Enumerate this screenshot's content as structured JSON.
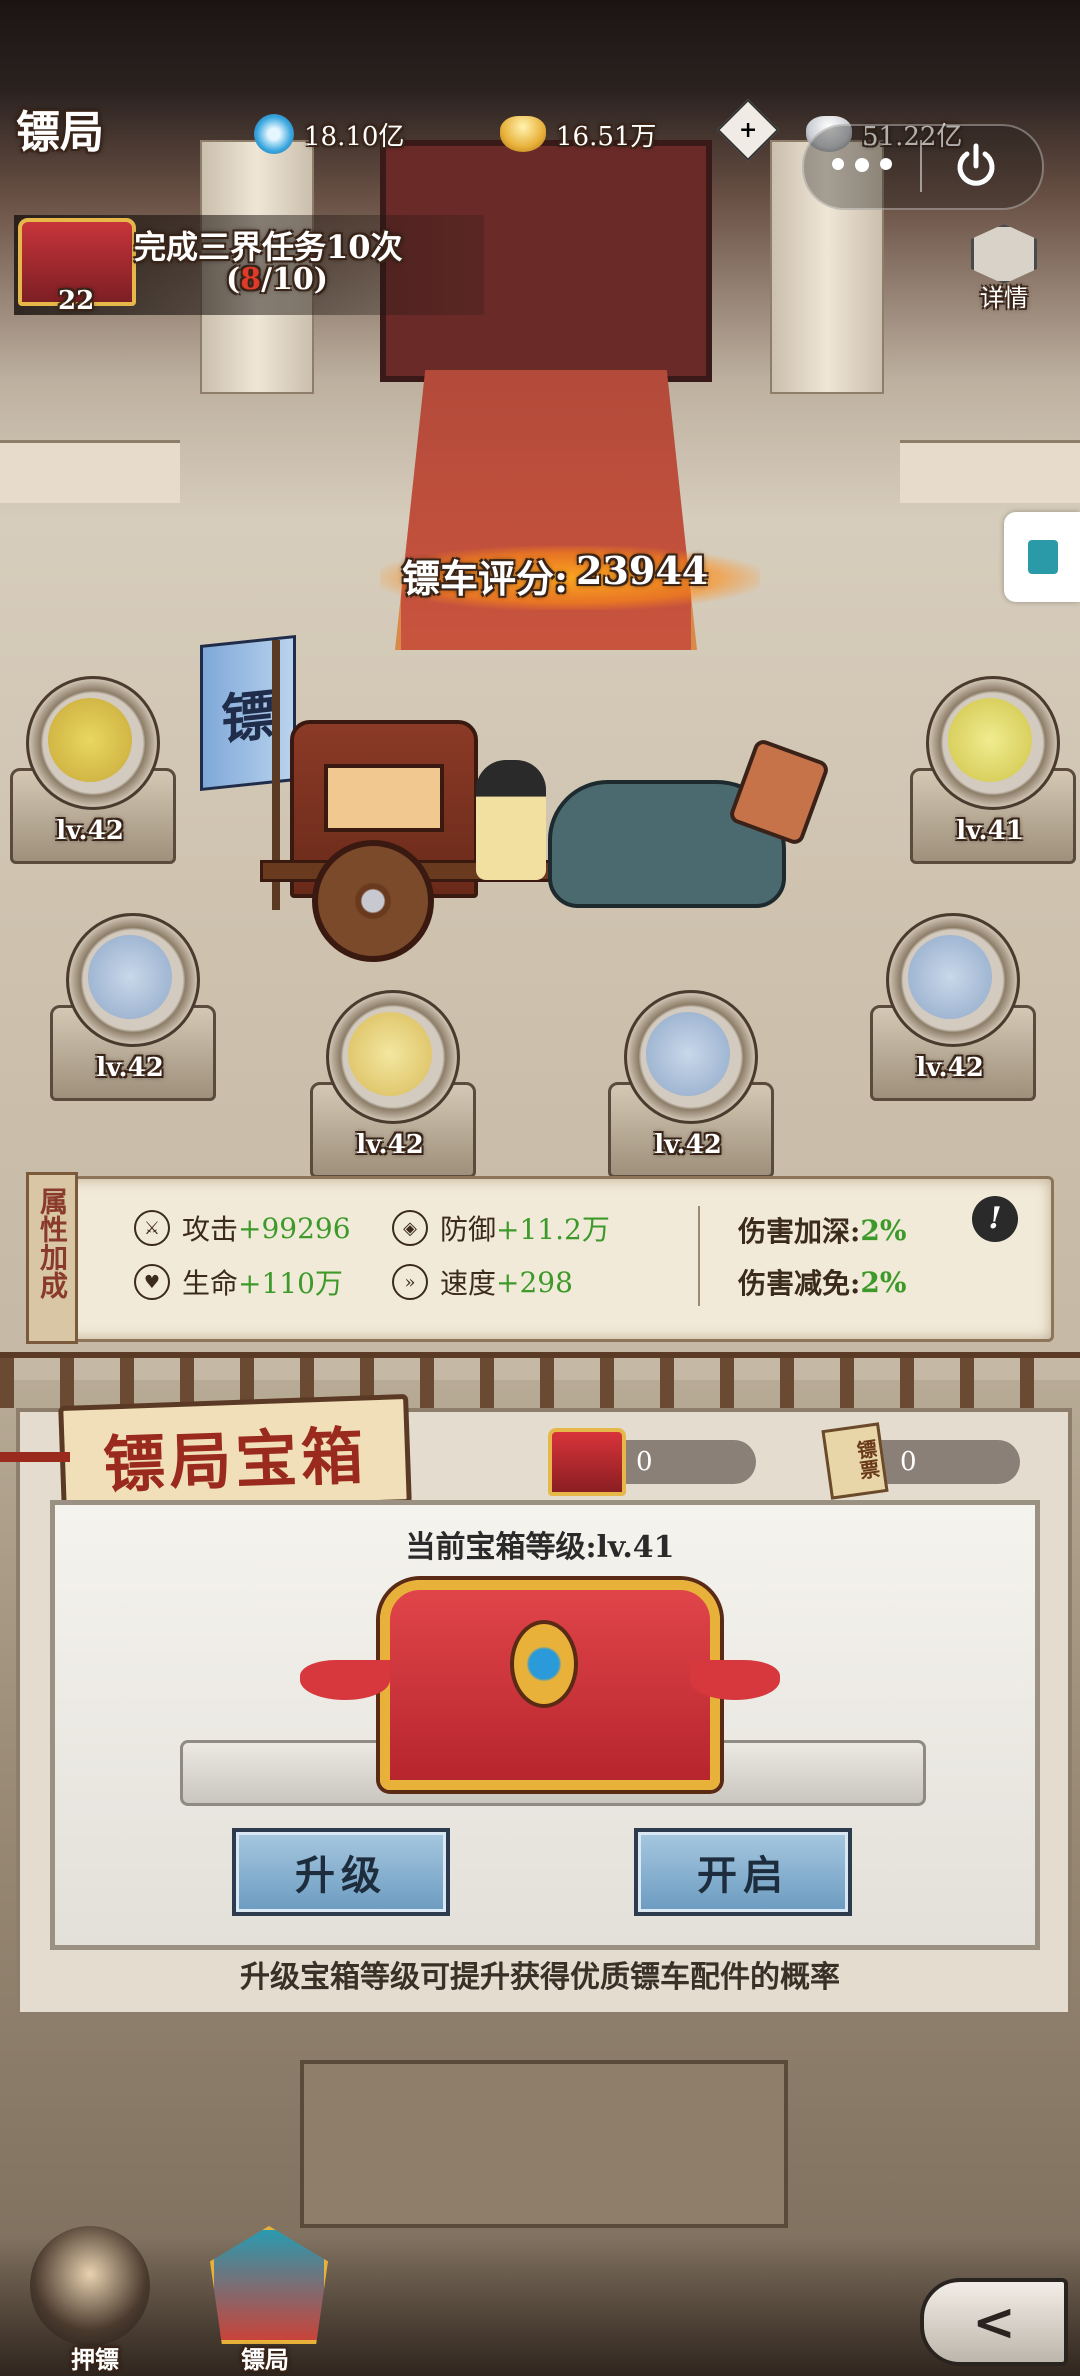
{
  "header": {
    "title": "镖局",
    "currencies": [
      {
        "icon": "spirit-orb-icon",
        "value": "18.10亿",
        "color": "#3aa7e0"
      },
      {
        "icon": "gold-ingot-icon",
        "value": "16.51万",
        "color": "#e8b13a"
      },
      {
        "icon": "silver-ingot-icon",
        "value": "51.22亿",
        "color": "#c9cdd2"
      }
    ]
  },
  "task": {
    "level": "22",
    "text": "完成三界任务10次",
    "progress_current": "8",
    "progress_total": "/10)",
    "progress_open": "("
  },
  "detail_label": "详情",
  "cart_score": {
    "label": "镖车评分:",
    "value": "23944"
  },
  "flag_char": "镖",
  "slots": [
    {
      "name": "horse-gear",
      "level": "lv.42"
    },
    {
      "name": "blade",
      "level": "lv.41"
    },
    {
      "name": "carriage",
      "level": "lv.42"
    },
    {
      "name": "wheel",
      "level": "lv.42"
    },
    {
      "name": "banner",
      "level": "lv.42"
    },
    {
      "name": "escort",
      "level": "lv.42"
    }
  ],
  "stats": {
    "side_label": "属性加成",
    "attack_label": "攻击",
    "attack_value": "+99296",
    "defense_label": "防御",
    "defense_value": "+11.2万",
    "hp_label": "生命",
    "hp_value": "+110万",
    "speed_label": "速度",
    "speed_value": "+298",
    "dmg_deepen_label": "伤害加深:",
    "dmg_deepen_value": "2%",
    "dmg_reduce_label": "伤害减免:",
    "dmg_reduce_value": "2%",
    "info_symbol": "!"
  },
  "chest": {
    "title": "镖局宝箱",
    "chest_count": "0",
    "ticket_count": "0",
    "ticket_label": "镖票",
    "level_text": "当前宝箱等级:lv.41",
    "upgrade_button": "升级",
    "open_button": "开启",
    "hint": "升级宝箱等级可提升获得优质镖车配件的概率"
  },
  "nav": {
    "escort_label": "押镖",
    "agency_label": "镖局"
  }
}
